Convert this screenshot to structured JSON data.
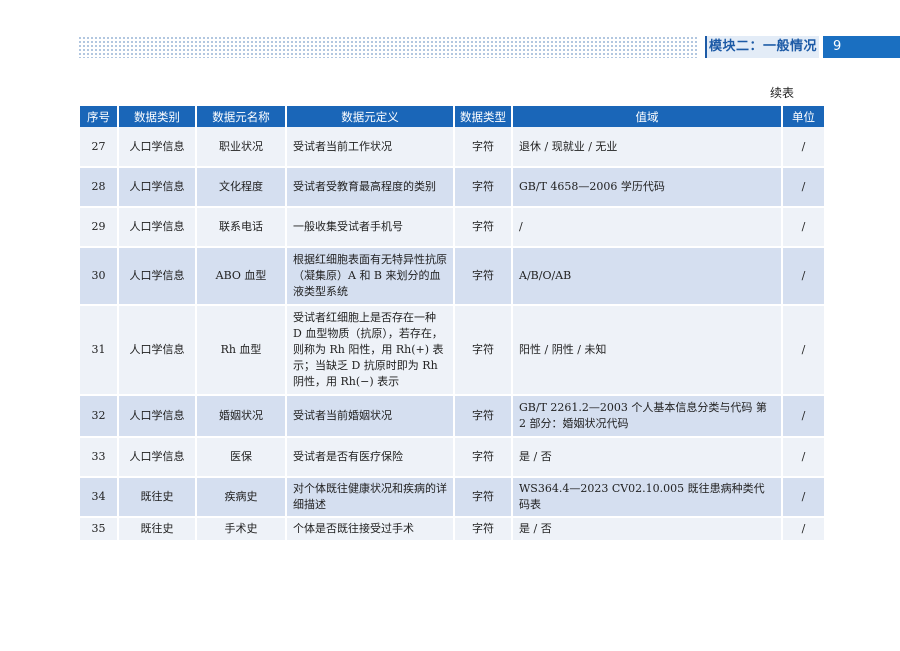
{
  "header": {
    "module_title": "模块二：一般情况",
    "page_number": "9"
  },
  "continued_label": "续表",
  "table": {
    "columns": [
      "序号",
      "数据类别",
      "数据元名称",
      "数据元定义",
      "数据类型",
      "值域",
      "单位"
    ],
    "rows": [
      {
        "no": "27",
        "category": "人口学信息",
        "name": "职业状况",
        "definition": "受试者当前工作状况",
        "type": "字符",
        "domain": "退休 / 现就业 / 无业",
        "unit": "/"
      },
      {
        "no": "28",
        "category": "人口学信息",
        "name": "文化程度",
        "definition": "受试者受教育最高程度的类别",
        "type": "字符",
        "domain": "GB/T 4658—2006 学历代码",
        "unit": "/"
      },
      {
        "no": "29",
        "category": "人口学信息",
        "name": "联系电话",
        "definition": "一般收集受试者手机号",
        "type": "字符",
        "domain": "/",
        "unit": "/"
      },
      {
        "no": "30",
        "category": "人口学信息",
        "name": "ABO 血型",
        "definition": "根据红细胞表面有无特异性抗原（凝集原）A 和 B 来划分的血液类型系统",
        "type": "字符",
        "domain": "A/B/O/AB",
        "unit": "/"
      },
      {
        "no": "31",
        "category": "人口学信息",
        "name": "Rh 血型",
        "definition": "受试者红细胞上是否存在一种 D 血型物质（抗原），若存在，则称为 Rh 阳性，用 Rh(+) 表示；当缺乏 D 抗原时即为 Rh 阴性，用 Rh(−) 表示",
        "type": "字符",
        "domain": "阳性 / 阴性 / 未知",
        "unit": "/"
      },
      {
        "no": "32",
        "category": "人口学信息",
        "name": "婚姻状况",
        "definition": "受试者当前婚姻状况",
        "type": "字符",
        "domain": "GB/T 2261.2—2003 个人基本信息分类与代码 第 2 部分：婚姻状况代码",
        "unit": "/"
      },
      {
        "no": "33",
        "category": "人口学信息",
        "name": "医保",
        "definition": "受试者是否有医疗保险",
        "type": "字符",
        "domain": "是 / 否",
        "unit": "/"
      },
      {
        "no": "34",
        "category": "既往史",
        "name": "疾病史",
        "definition": "对个体既往健康状况和疾病的详细描述",
        "type": "字符",
        "domain": "WS364.4—2023 CV02.10.005 既往患病种类代码表",
        "unit": "/"
      },
      {
        "no": "35",
        "category": "既往史",
        "name": "手术史",
        "definition": "个体是否既往接受过手术",
        "type": "字符",
        "domain": "是 / 否",
        "unit": "/"
      }
    ]
  }
}
